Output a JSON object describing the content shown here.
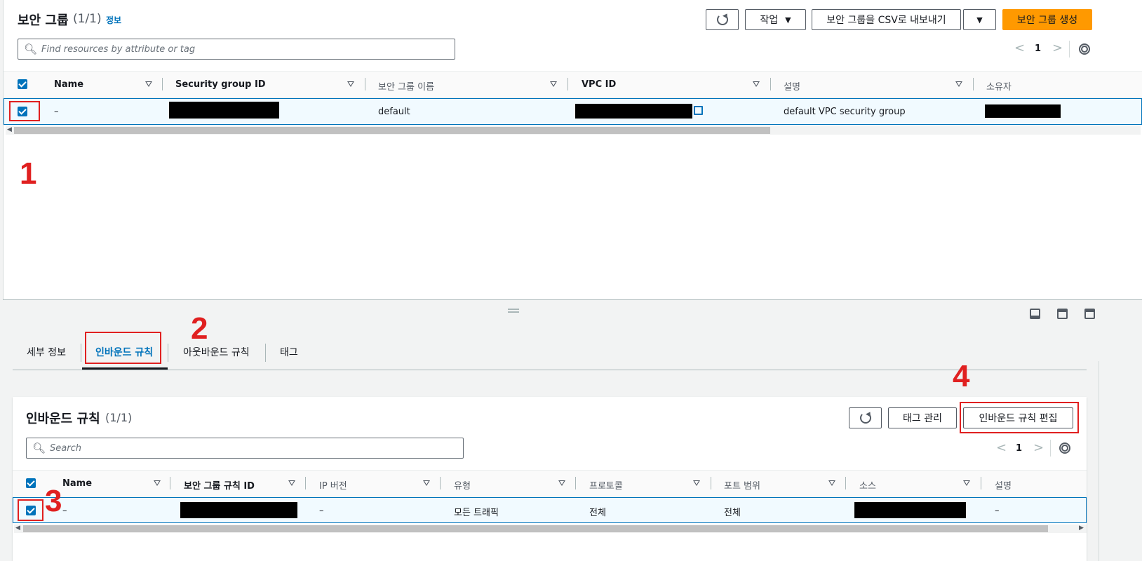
{
  "top": {
    "title": "보안 그룹",
    "count": "(1/1)",
    "info_link": "정보",
    "actions_label": "작업",
    "export_label": "보안 그룹을 CSV로 내보내기",
    "create_label": "보안 그룹 생성",
    "search_placeholder": "Find resources by attribute or tag",
    "page": "1",
    "columns": [
      "Name",
      "Security group ID",
      "보안 그룹 이름",
      "VPC ID",
      "설명",
      "소유자"
    ],
    "row": {
      "name": "–",
      "sg_name": "default",
      "description": "default VPC security group"
    }
  },
  "tabs": [
    "세부 정보",
    "인바운드 규칙",
    "아웃바운드 규칙",
    "태그"
  ],
  "inbound": {
    "title": "인바운드 규칙",
    "count": "(1/1)",
    "manage_tags_label": "태그 관리",
    "edit_label": "인바운드 규칙 편집",
    "search_placeholder": "Search",
    "page": "1",
    "columns": [
      "Name",
      "보안 그룹 규칙 ID",
      "IP 버전",
      "유형",
      "프로토콜",
      "포트 범위",
      "소스",
      "설명"
    ],
    "row": {
      "name": "–",
      "ip_version": "–",
      "type": "모든 트래픽",
      "protocol": "전체",
      "port_range": "전체",
      "description": "–"
    }
  },
  "annotations": [
    "1",
    "2",
    "3",
    "4"
  ],
  "colors": {
    "accent": "#0073bb",
    "primary_button": "#ff9900",
    "annotation": "#e02020"
  }
}
